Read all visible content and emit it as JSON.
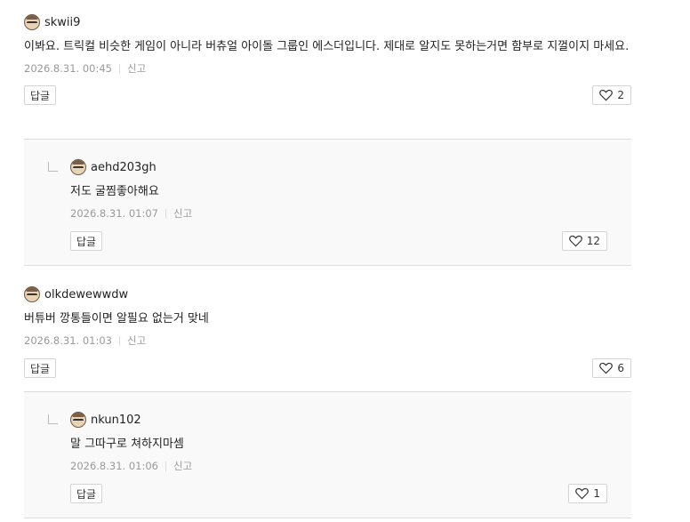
{
  "comments": [
    {
      "nick": "skwii9",
      "text": "이봐요. 트릭컬 비슷한 게임이 아니라 버츄얼 아이돌 그룹인 에스더입니다. 제대로 알지도 못하는거면 함부로 지껄이지 마세요.",
      "date": "2026.8.31. 00:45",
      "report": "신고",
      "reply_label": "답글",
      "likes": "2"
    },
    {
      "nick": "aehd203gh",
      "text": "저도 굴찜좋아해요",
      "date": "2026.8.31. 01:07",
      "report": "신고",
      "reply_label": "답글",
      "likes": "12"
    },
    {
      "nick": "olkdewewwdw",
      "text": "버튜버 깡통들이면 알필요 없는거 맞네",
      "date": "2026.8.31. 01:03",
      "report": "신고",
      "reply_label": "답글",
      "likes": "6"
    },
    {
      "nick": "nkun102",
      "text": "말 그따구로 쳐하지마셈",
      "date": "2026.8.31. 01:06",
      "report": "신고",
      "reply_label": "답글",
      "likes": "1"
    }
  ],
  "icons": {
    "avatar": "avatar-icon",
    "like": "heart-icon",
    "reply_indicator": "reply-arrow-icon"
  },
  "colors": {
    "meta_text": "#999999",
    "reply_bg": "#f9f9f9",
    "border": "#d4d4d4"
  }
}
